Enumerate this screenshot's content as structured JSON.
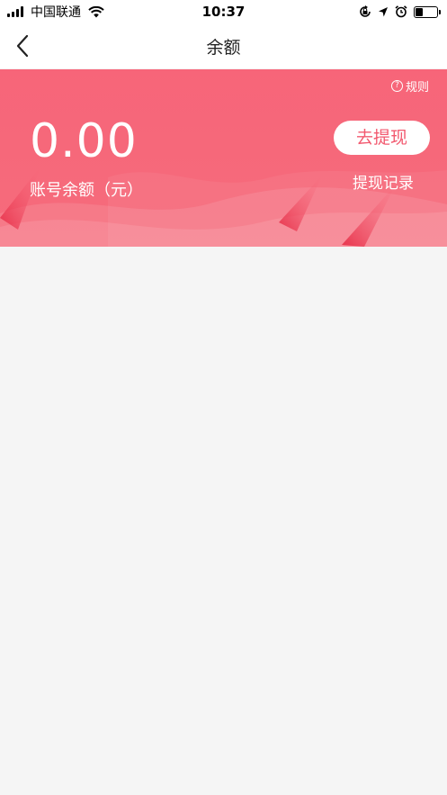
{
  "status_bar": {
    "carrier": "中国联通",
    "time": "10:37"
  },
  "nav": {
    "title": "余额"
  },
  "balance_card": {
    "rules_label": "规则",
    "amount": "0.00",
    "amount_label": "账号余额（元）",
    "withdraw_button": "去提现",
    "withdraw_records": "提现记录"
  },
  "colors": {
    "banner": "#f76579",
    "accent_text": "#f2596f",
    "background": "#f5f5f5"
  }
}
